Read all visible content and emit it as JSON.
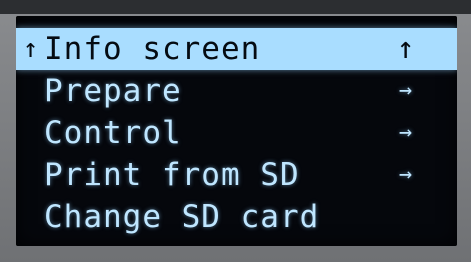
{
  "menu": {
    "items": [
      {
        "label": "Info screen",
        "prefix": "↑",
        "suffix": "↑",
        "selected": true
      },
      {
        "label": "Prepare",
        "prefix": "",
        "suffix": "→",
        "selected": false
      },
      {
        "label": "Control",
        "prefix": "",
        "suffix": "→",
        "selected": false
      },
      {
        "label": "Print from SD",
        "prefix": "",
        "suffix": "→",
        "selected": false
      },
      {
        "label": "Change SD card",
        "prefix": "",
        "suffix": "",
        "selected": false
      }
    ]
  },
  "colors": {
    "screen_bg": "#05070c",
    "text": "#bfe6ff",
    "highlight_bg": "#a9ddff",
    "highlight_text": "#050b12"
  }
}
